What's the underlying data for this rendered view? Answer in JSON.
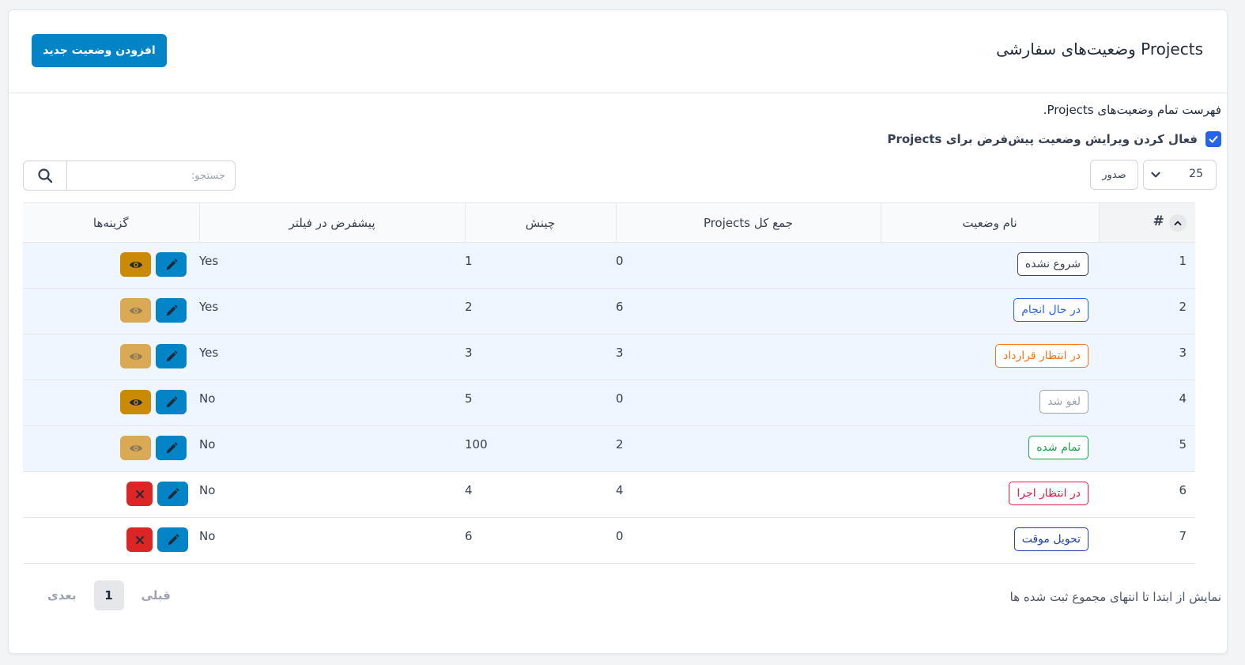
{
  "header": {
    "title": "Projects وضعیت‌های سفارشی",
    "add_button": "افزودن وضعیت جدید"
  },
  "description": "فهرست تمام وضعیت‌های Projects.",
  "default_edit": {
    "label": "فعال کردن ویرایش وضعیت پیش‌فرض برای Projects",
    "checked": true
  },
  "controls": {
    "page_size": "25",
    "export_label": "صدور",
    "search_placeholder": "جستجو:"
  },
  "table": {
    "headers": {
      "num": "#",
      "name": "نام وضعیت",
      "total": "جمع کل Projects",
      "order": "چینش",
      "default_filter": "پیشفرض در فیلتر",
      "options": "گزینه‌ها"
    },
    "rows": [
      {
        "num": "1",
        "name": "شروع نشده",
        "color": "#374151",
        "total": "0",
        "order": "1",
        "default": "Yes",
        "highlight": true,
        "action": "view",
        "faded": false
      },
      {
        "num": "2",
        "name": "در حال انجام",
        "color": "#2563eb",
        "total": "6",
        "order": "2",
        "default": "Yes",
        "highlight": true,
        "action": "view",
        "faded": true
      },
      {
        "num": "3",
        "name": "در انتظار قرارداد",
        "color": "#f97316",
        "total": "3",
        "order": "3",
        "default": "Yes",
        "highlight": true,
        "action": "view",
        "faded": true
      },
      {
        "num": "4",
        "name": "لغو شد",
        "color": "#9ca3af",
        "total": "0",
        "order": "5",
        "default": "No",
        "highlight": true,
        "action": "view",
        "faded": false
      },
      {
        "num": "5",
        "name": "تمام شده",
        "color": "#16a34a",
        "total": "2",
        "order": "100",
        "default": "No",
        "highlight": true,
        "action": "view",
        "faded": true
      },
      {
        "num": "6",
        "name": "در انتظار اجرا",
        "color": "#e11d48",
        "total": "4",
        "order": "4",
        "default": "No",
        "highlight": false,
        "action": "delete",
        "faded": false
      },
      {
        "num": "7",
        "name": "تحویل موقت",
        "color": "#1e40af",
        "total": "0",
        "order": "6",
        "default": "No",
        "highlight": false,
        "action": "delete",
        "faded": false
      }
    ]
  },
  "footer": {
    "info": "نمایش از ابتدا تا انتهای مجموع ثبت شده ها",
    "prev": "قبلی",
    "current_page": "1",
    "next": "بعدی"
  },
  "icons": {
    "search": "search-icon",
    "edit": "pencil-icon",
    "view": "eye-icon",
    "delete": "close-icon",
    "sort": "chevron-up-icon",
    "dropdown": "chevron-down-icon",
    "checkbox": "check-icon"
  },
  "colors": {
    "primary": "#0284c7",
    "view": "#ca8a04",
    "view_faded": "#d9a954",
    "delete": "#dc2626",
    "checkbox": "#2563eb",
    "row_highlight": "#eff6ff"
  }
}
